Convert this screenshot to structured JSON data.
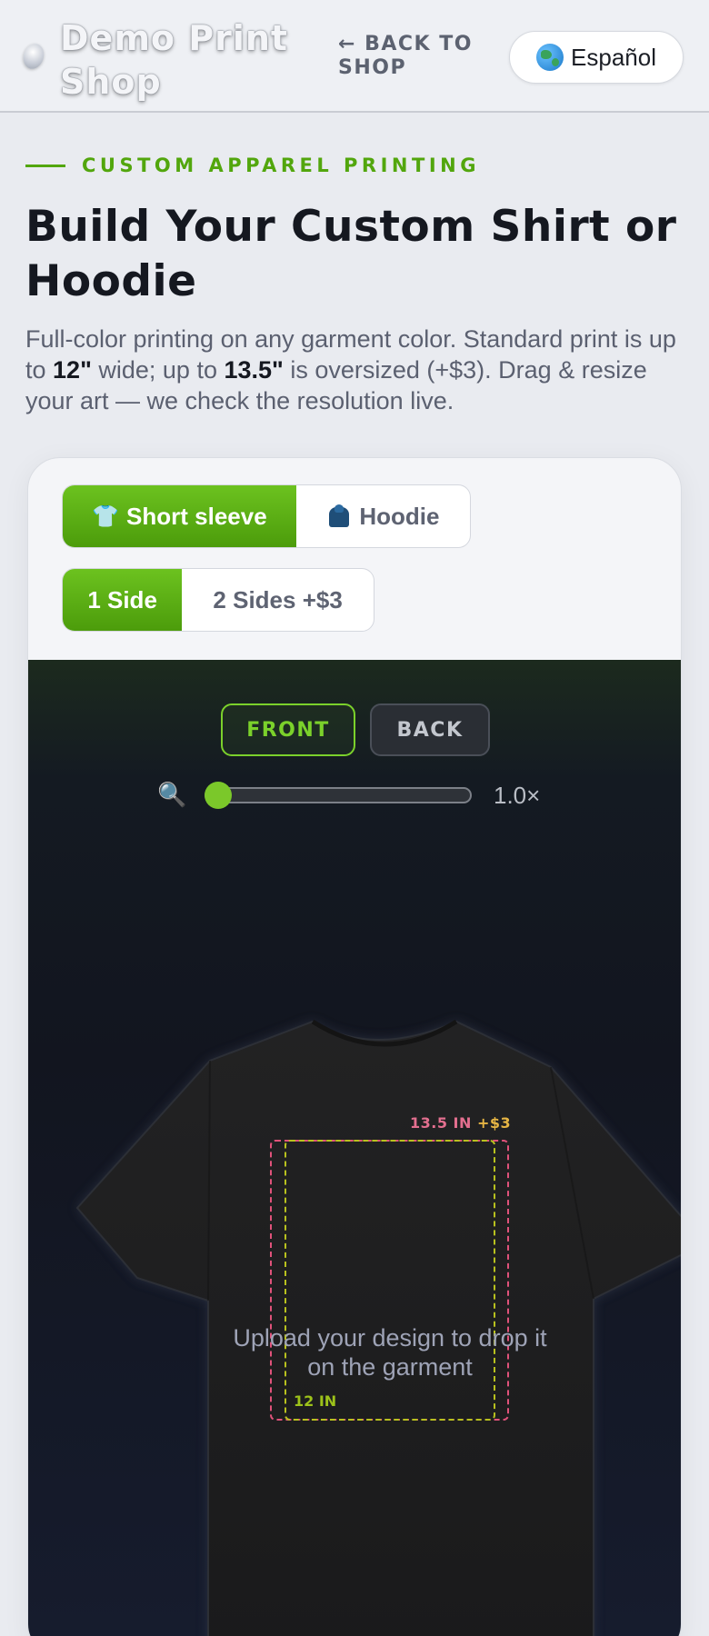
{
  "header": {
    "logo_text": "Demo Print Shop",
    "back_link": "← BACK TO SHOP",
    "language_label": "Español"
  },
  "hero": {
    "eyebrow": "CUSTOM APPAREL PRINTING",
    "title": "Build Your Custom Shirt or Hoodie",
    "description_part1": "Full-color printing on any garment color. Standard print is up to ",
    "description_bold1": "12\"",
    "description_part2": " wide; up to ",
    "description_bold2": "13.5\"",
    "description_part3": " is oversized (+$3). Drag & resize your art — we check the resolution live."
  },
  "garment_options": [
    {
      "label": "Short sleeve",
      "icon": "shirt-icon",
      "active": true
    },
    {
      "label": "Hoodie",
      "icon": "hoodie-icon",
      "active": false
    }
  ],
  "side_options": [
    {
      "label": "1 Side",
      "active": true
    },
    {
      "label": "2 Sides +$3",
      "active": false
    }
  ],
  "view_tabs": {
    "front": "FRONT",
    "back": "BACK",
    "active": "front"
  },
  "zoom": {
    "value_label": "1.0×",
    "value": 1.0
  },
  "print_area": {
    "oversize_label": "13.5 IN",
    "oversize_price": "+$3",
    "standard_label": "12 IN",
    "oversize_color": "#e0527a",
    "standard_color": "#b8c11e"
  },
  "upload_hint": "Upload your design to drop it on the garment",
  "colors": {
    "accent": "#52a60d",
    "garment": "#1f1f20"
  }
}
